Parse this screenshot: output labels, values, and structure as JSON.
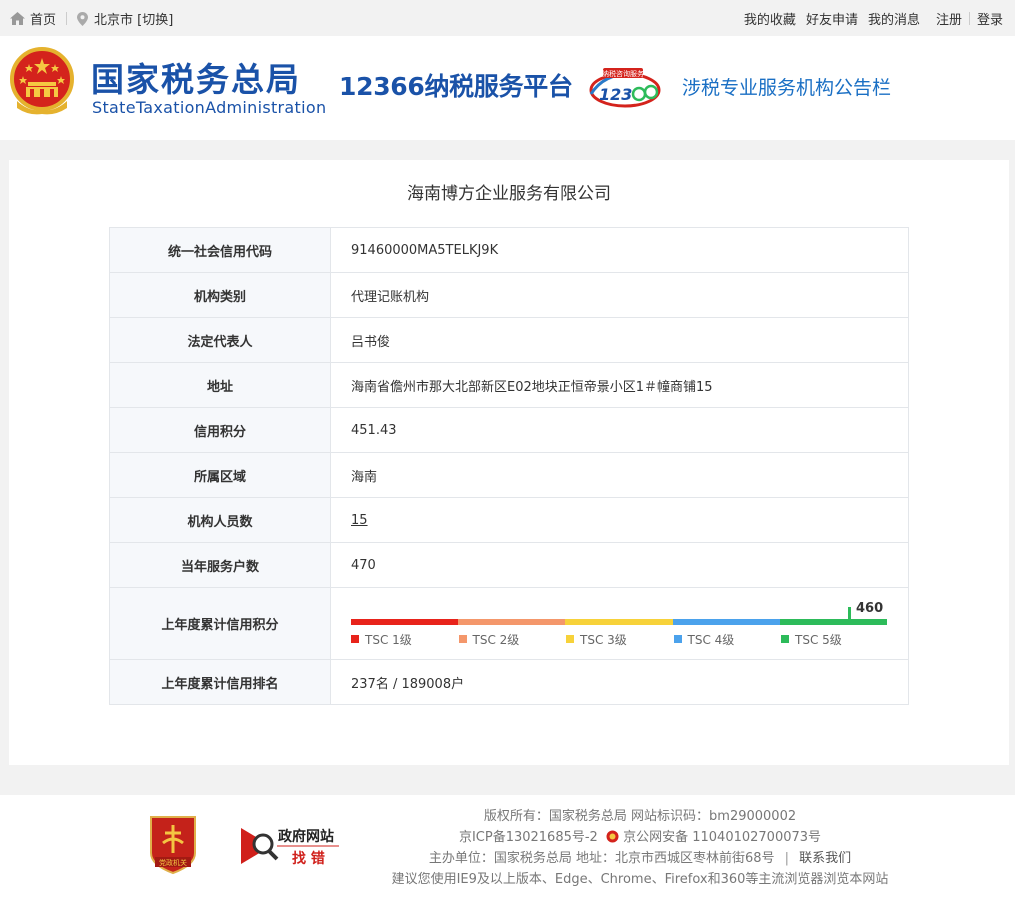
{
  "topbar": {
    "home": "首页",
    "city": "北京市 [切换]",
    "links": [
      "我的收藏",
      "好友申请",
      "我的消息",
      "注册",
      "登录"
    ]
  },
  "header": {
    "brand_cn": "国家税务总局",
    "brand_en": "StateTaxationAdministration",
    "platform": "12366纳税服务平台",
    "logo_badge": "纳税咨询服务",
    "subtitle": "涉税专业服务机构公告栏"
  },
  "company": {
    "name": "海南博方企业服务有限公司",
    "rows": [
      {
        "label": "统一社会信用代码",
        "value": "91460000MA5TELKJ9K"
      },
      {
        "label": "机构类别",
        "value": "代理记账机构"
      },
      {
        "label": "法定代表人",
        "value": "吕书俊"
      },
      {
        "label": "地址",
        "value": "海南省儋州市那大北部新区E02地块正恒帝景小区1＃幢商铺15"
      },
      {
        "label": "信用积分",
        "value": "451.43"
      },
      {
        "label": "所属区域",
        "value": "海南"
      },
      {
        "label": "机构人员数",
        "value": "15"
      },
      {
        "label": "当年服务户数",
        "value": "470"
      }
    ],
    "credit_label": "上年度累计信用积分",
    "credit_score": 460,
    "credit_marker_fraction": 0.93,
    "levels": [
      {
        "name": "TSC 1级",
        "color": "#e8231b"
      },
      {
        "name": "TSC 2级",
        "color": "#f4976b"
      },
      {
        "name": "TSC 3级",
        "color": "#f7d23a"
      },
      {
        "name": "TSC 4级",
        "color": "#4ba2ec"
      },
      {
        "name": "TSC 5级",
        "color": "#2dbb5a"
      }
    ],
    "rank_label": "上年度累计信用排名",
    "rank_value": "237名 / 189008户"
  },
  "footer": {
    "party_badge": "党政机关",
    "gov_title": "政府网站",
    "gov_sub": "找 错",
    "line1": "版权所有：国家税务总局 网站标识码：bm29000002",
    "line2a": "京ICP备13021685号-2",
    "line2b": "京公网安备 11040102700073号",
    "line3a": "主办单位：国家税务总局 地址：北京市西城区枣林前街68号",
    "line3b": "联系我们",
    "line4": "建议您使用IE9及以上版本、Edge、Chrome、Firefox和360等主流浏览器浏览本网站"
  }
}
